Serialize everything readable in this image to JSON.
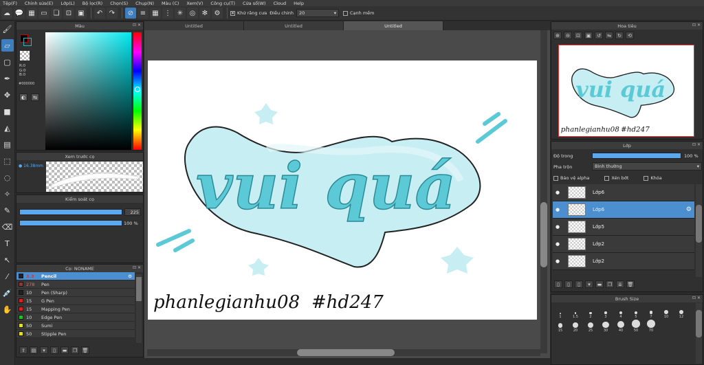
{
  "menu": [
    "Tệp(F)",
    "Chỉnh sửa(E)",
    "Lớp(L)",
    "Bộ lọc(R)",
    "Chọn(S)",
    "Chụp(N)",
    "Màu (C)",
    "Xem(V)",
    "Công cụ(T)",
    "Cửa sổ(W)",
    "Cloud",
    "Help"
  ],
  "toolbar": {
    "antialias_label": "Khử răng cưa",
    "correction_label": "Điều chỉnh",
    "correction_value": "20",
    "snap_label": "Cạnh mềm"
  },
  "color_panel": {
    "title": "Màu",
    "r": "R:0",
    "g": "G:0",
    "b": "B:0",
    "hex": "#000000",
    "fg_color": "#000000",
    "bg_color": "#ffffff"
  },
  "brush_preview": {
    "title": "Xem trước cọ",
    "size": "16.38mm"
  },
  "brush_control": {
    "title": "Kiểm soát cọ",
    "size_value": "225",
    "opacity_value": "100 %"
  },
  "brush_list": {
    "title": "Cọ: NONAME",
    "items": [
      {
        "size": "3.3",
        "name": "Pencil",
        "color": "#222222",
        "active": true
      },
      {
        "size": "278",
        "name": "Pen",
        "color": "#8a3a3a",
        "active": false
      },
      {
        "size": "10",
        "name": "Pen (Sharp)",
        "color": "#222222",
        "active": false
      },
      {
        "size": "15",
        "name": "G Pen",
        "color": "#e02020",
        "active": false
      },
      {
        "size": "15",
        "name": "Mapping Pen",
        "color": "#e02020",
        "active": false
      },
      {
        "size": "10",
        "name": "Edge Pen",
        "color": "#20c020",
        "active": false
      },
      {
        "size": "50",
        "name": "Sumi",
        "color": "#e0e020",
        "active": false
      },
      {
        "size": "50",
        "name": "Stipple Pen",
        "color": "#e0e020",
        "active": false
      }
    ]
  },
  "doc_tabs": [
    "Untitled",
    "Untitled",
    "Untitled"
  ],
  "canvas_art": {
    "main_text": "vui quá",
    "signature": "phanlegianhu08",
    "hashtag": "#hd247",
    "accent": "#5ccad6",
    "light": "#c7eef3"
  },
  "navigator": {
    "title": "Hoa tiêu"
  },
  "layer_panel": {
    "title": "Lớp",
    "opacity_label": "Độ trong",
    "opacity_value": "100 %",
    "opacity_fraction": 1.0,
    "blend_label": "Pha trộn",
    "blend_value": "Bình thường",
    "protect_alpha": "Bảo vệ alpha",
    "clipping": "Xén bớt",
    "lock": "Khóa",
    "layers": [
      {
        "name": "Lớp6",
        "active": false
      },
      {
        "name": "Lớp6",
        "active": true
      },
      {
        "name": "Lớp5",
        "active": false
      },
      {
        "name": "Lớp2",
        "active": false
      },
      {
        "name": "Lớp2",
        "active": false
      }
    ]
  },
  "brush_size": {
    "title": "Brush Size",
    "sizes": [
      "1",
      "1.5",
      "2",
      "3",
      "4",
      "5",
      "7",
      "10",
      "12",
      "15",
      "20",
      "25",
      "30",
      "40",
      "50",
      "70"
    ]
  }
}
